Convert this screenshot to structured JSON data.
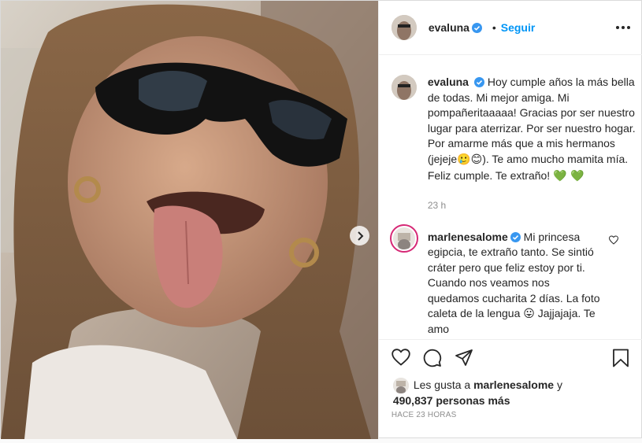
{
  "post": {
    "author": "evaluna",
    "follow_label": "Seguir",
    "header_bullet": "•",
    "caption_text": "Hoy cumple años la más bella de todas. Mi mejor amiga. Mi pompañeritaaaaa! Gracias por ser nuestro lugar para aterrizar. Por ser nuestro hogar. Por amarme más que a mis hermanos (jejeje",
    "caption_emoji_1": "🥲",
    "caption_emoji_2": "😊",
    "caption_text_end": "). Te amo mucho mamita mía. Feliz cumple. Te extraño! ",
    "caption_hearts": "💚 💚",
    "caption_age": "23 h"
  },
  "comment": {
    "author": "marlenesalome",
    "text": "Mi princesa egipcia, te extraño tanto. Se sintió cráter pero que feliz estoy por ti. Cuando nos veamos nos quedamos cucharita 2 días. La foto caleta de la lengua ",
    "emoji": "😛",
    "text_end": " Jajjajaja. Te amo"
  },
  "likes": {
    "prefix": "Les gusta a",
    "user": "marlenesalome",
    "connector": "y",
    "count": "490,837 personas más"
  },
  "timestamp": "HACE 23 HORAS",
  "icons": {
    "verified": "verified-badge-icon",
    "like": "heart-icon",
    "comment": "comment-icon",
    "share": "paper-plane-icon",
    "save": "bookmark-icon",
    "more": "more-options-icon",
    "next": "chevron-right-icon"
  },
  "colors": {
    "accent": "#0095f6",
    "verified": "#3897f0",
    "muted": "#8e8e8e",
    "text": "#262626",
    "border": "#dbdbdb"
  }
}
